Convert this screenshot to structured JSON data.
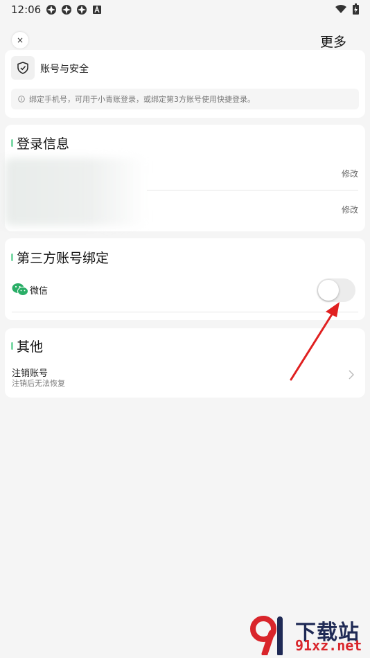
{
  "status_bar": {
    "time": "12:06",
    "left_icons": [
      "app-icon",
      "app-icon",
      "app-icon",
      "a-icon"
    ],
    "right_icons": [
      "wifi-icon",
      "battery-icon"
    ]
  },
  "header": {
    "close_label": "×",
    "more_label": "更多"
  },
  "account_card": {
    "title": "账号与安全",
    "tip": "绑定手机号，可用于小青账登录，或绑定第3方账号使用快捷登录。"
  },
  "login_section": {
    "title": "登录信息",
    "rows": [
      {
        "action": "修改"
      },
      {
        "action": "修改"
      }
    ]
  },
  "third_party_section": {
    "title": "第三方账号绑定",
    "items": [
      {
        "name": "微信",
        "bound": false
      }
    ]
  },
  "other_section": {
    "title": "其他",
    "items": [
      {
        "title": "注销账号",
        "subtitle": "注销后无法恢复"
      }
    ]
  },
  "watermark": {
    "line1": "下载站",
    "line2": "91xz.net"
  },
  "colors": {
    "accent_green": "#7ed9a8",
    "wechat_green": "#2aae67",
    "arrow_red": "#e02020"
  }
}
